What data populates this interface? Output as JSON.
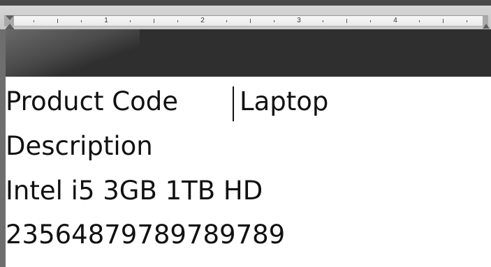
{
  "ruler": {
    "numbers": [
      "1",
      "2",
      "3",
      "4"
    ]
  },
  "document": {
    "row1": {
      "label": "Product Code",
      "value": "Laptop"
    },
    "line2": "Description",
    "line3": "Intel i5 3GB 1TB HD",
    "line4": "23564879789789789"
  },
  "colors": {
    "ruler_background": "#d6d6d6",
    "canvas_dark": "#2f2f2f",
    "page": "#ffffff",
    "text": "#111111"
  }
}
